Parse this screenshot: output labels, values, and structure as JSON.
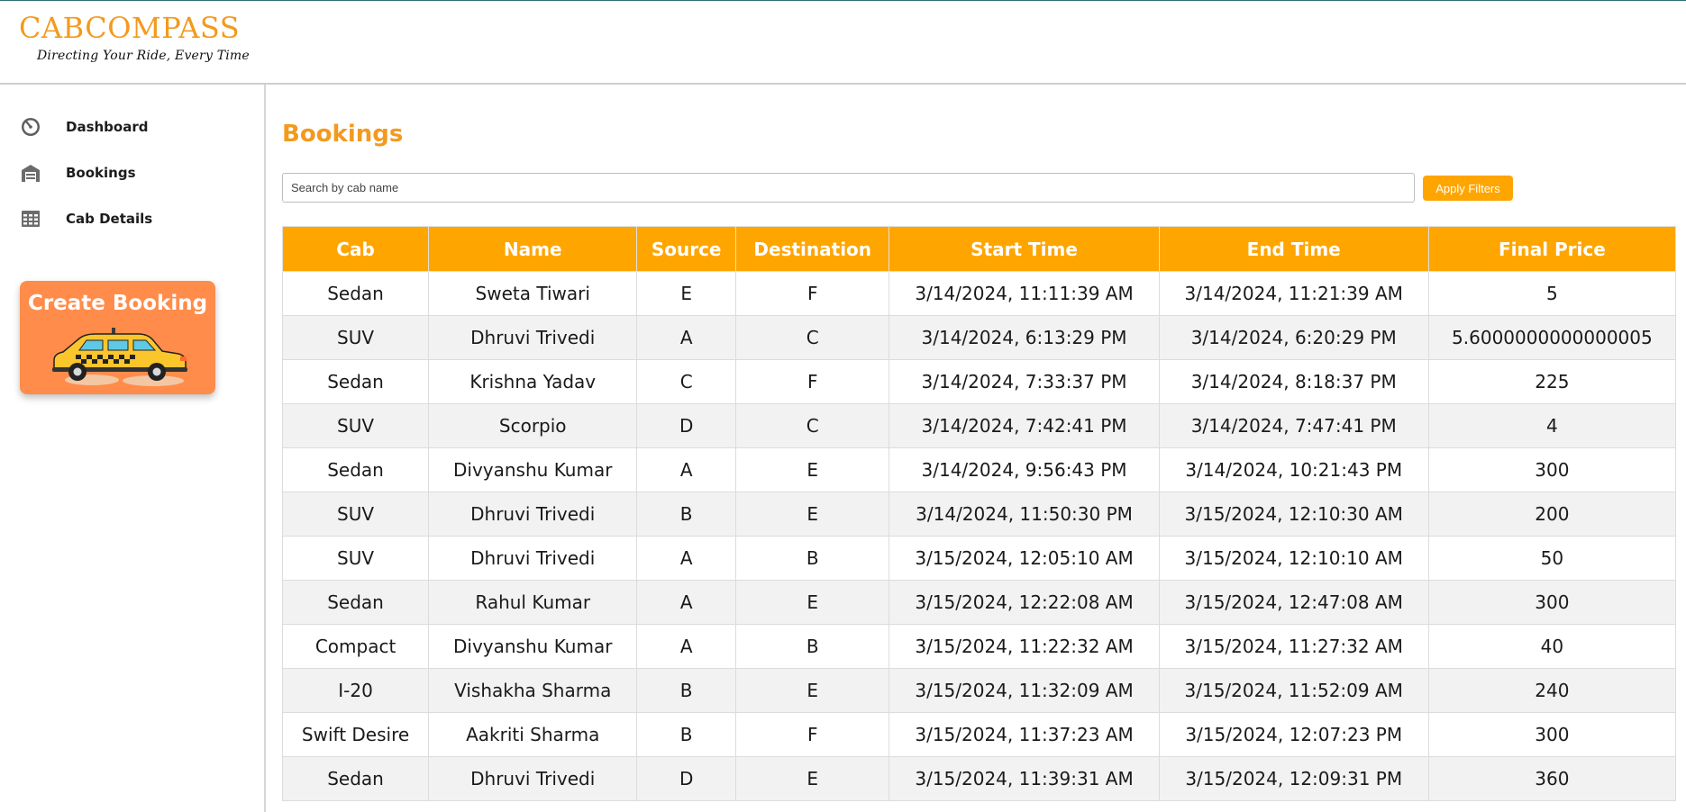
{
  "brand": {
    "name": "CABCOMPASS",
    "tagline": "Directing Your Ride, Every Time"
  },
  "sidebar": {
    "items": [
      {
        "label": "Dashboard",
        "icon": "gauge-icon"
      },
      {
        "label": "Bookings",
        "icon": "garage-icon"
      },
      {
        "label": "Cab Details",
        "icon": "table-grid-icon"
      }
    ],
    "create_card": {
      "label": "Create Booking",
      "icon": "taxi-icon"
    }
  },
  "page": {
    "title": "Bookings"
  },
  "search": {
    "placeholder": "Search by cab name",
    "value": ""
  },
  "filters": {
    "apply_label": "Apply Filters"
  },
  "table": {
    "headers": [
      "Cab",
      "Name",
      "Source",
      "Destination",
      "Start Time",
      "End Time",
      "Final Price"
    ],
    "rows": [
      [
        "Sedan",
        "Sweta Tiwari",
        "E",
        "F",
        "3/14/2024, 11:11:39 AM",
        "3/14/2024, 11:21:39 AM",
        "5"
      ],
      [
        "SUV",
        "Dhruvi Trivedi",
        "A",
        "C",
        "3/14/2024, 6:13:29 PM",
        "3/14/2024, 6:20:29 PM",
        "5.6000000000000005"
      ],
      [
        "Sedan",
        "Krishna Yadav",
        "C",
        "F",
        "3/14/2024, 7:33:37 PM",
        "3/14/2024, 8:18:37 PM",
        "225"
      ],
      [
        "SUV",
        "Scorpio",
        "D",
        "C",
        "3/14/2024, 7:42:41 PM",
        "3/14/2024, 7:47:41 PM",
        "4"
      ],
      [
        "Sedan",
        "Divyanshu Kumar",
        "A",
        "E",
        "3/14/2024, 9:56:43 PM",
        "3/14/2024, 10:21:43 PM",
        "300"
      ],
      [
        "SUV",
        "Dhruvi Trivedi",
        "B",
        "E",
        "3/14/2024, 11:50:30 PM",
        "3/15/2024, 12:10:30 AM",
        "200"
      ],
      [
        "SUV",
        "Dhruvi Trivedi",
        "A",
        "B",
        "3/15/2024, 12:05:10 AM",
        "3/15/2024, 12:10:10 AM",
        "50"
      ],
      [
        "Sedan",
        "Rahul Kumar",
        "A",
        "E",
        "3/15/2024, 12:22:08 AM",
        "3/15/2024, 12:47:08 AM",
        "300"
      ],
      [
        "Compact",
        "Divyanshu Kumar",
        "A",
        "B",
        "3/15/2024, 11:22:32 AM",
        "3/15/2024, 11:27:32 AM",
        "40"
      ],
      [
        "I-20",
        "Vishakha Sharma",
        "B",
        "E",
        "3/15/2024, 11:32:09 AM",
        "3/15/2024, 11:52:09 AM",
        "240"
      ],
      [
        "Swift Desire",
        "Aakriti Sharma",
        "B",
        "F",
        "3/15/2024, 11:37:23 AM",
        "3/15/2024, 12:07:23 PM",
        "300"
      ],
      [
        "Sedan",
        "Dhruvi Trivedi",
        "D",
        "E",
        "3/15/2024, 11:39:31 AM",
        "3/15/2024, 12:09:31 PM",
        "360"
      ]
    ]
  },
  "colors": {
    "accent": "#ffa500",
    "title": "#f39a1e",
    "card": "#ff8c4a",
    "row_alt": "#f2f2f2"
  }
}
